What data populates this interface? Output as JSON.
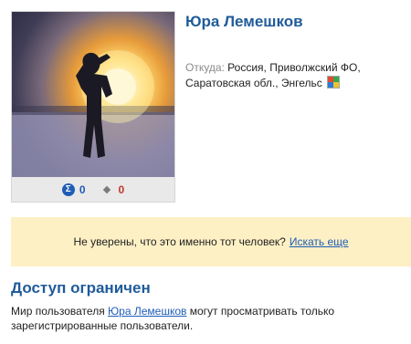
{
  "profile": {
    "name": "Юра Лемешков",
    "location_label": "Откуда:",
    "location_text": "Россия, Приволжский ФО, Саратовская обл., Энгельс",
    "stats": {
      "sigma_value": "0",
      "diamond_value": "0"
    }
  },
  "notice": {
    "text": "Не уверены, что это именно тот человек?",
    "link": "Искать еще"
  },
  "restricted": {
    "title": "Доступ ограничен",
    "text_before": "Мир пользователя",
    "user_link": "Юра Лемешков",
    "text_after": "могут просматривать только зарегистрированные пользователи."
  },
  "colors": {
    "accent": "#1f5b9a",
    "link": "#1f5db7",
    "notice_bg": "#fdf0c4"
  }
}
